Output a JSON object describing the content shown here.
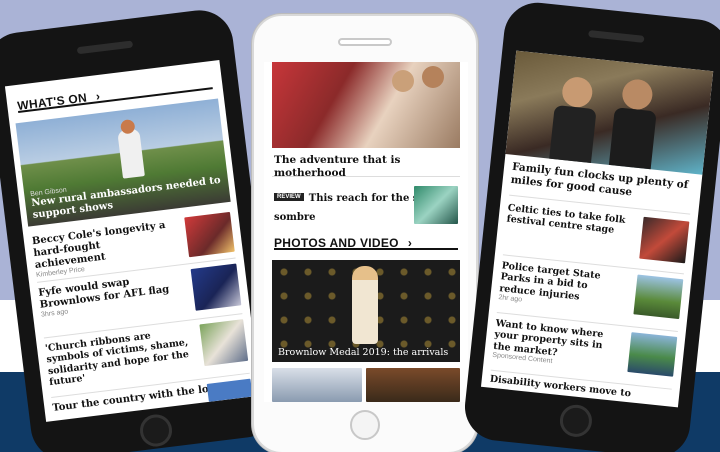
{
  "left_phone": {
    "section_title": "WHAT'S ON",
    "chevron": "›",
    "hero": {
      "byline": "Ben Gibson",
      "headline": "New rural ambassadors needed to support shows"
    },
    "items": [
      {
        "headline": "Beccy Cole's longevity a hard-fought achievement",
        "meta": "Kimberley Price"
      },
      {
        "headline": "Fyfe would swap Brownlows for AFL flag",
        "meta": "3hrs ago"
      },
      {
        "headline": "'Church ribbons are symbols of victims, shame, solidarity and hope for the future'",
        "meta": ""
      },
      {
        "headline": "Tour the country with the lot -",
        "meta": ""
      }
    ]
  },
  "center_phone": {
    "top_headline": "The adventure that is motherhood",
    "review": {
      "badge": "REVIEW",
      "headline": "This reach for the stars is sombre"
    },
    "section_title": "PHOTOS AND VIDEO",
    "chevron": "›",
    "gallery_caption": "Brownlow Medal 2019: the arrivals"
  },
  "right_phone": {
    "hero_headline": "Family fun clocks up plenty of miles for good cause",
    "items": [
      {
        "headline": "Celtic ties to take folk festival centre stage",
        "meta": ""
      },
      {
        "headline": "Police target State Parks in a bid to reduce injuries",
        "meta": "2hr ago"
      },
      {
        "headline": "Want to know where your property sits in the market?",
        "meta": "Sponsored Content"
      },
      {
        "headline": "Disability workers move to",
        "meta": ""
      }
    ]
  },
  "colors": {
    "sky": "#aab3d6",
    "navy": "#0f3a66",
    "phone_dark": "#141414"
  }
}
